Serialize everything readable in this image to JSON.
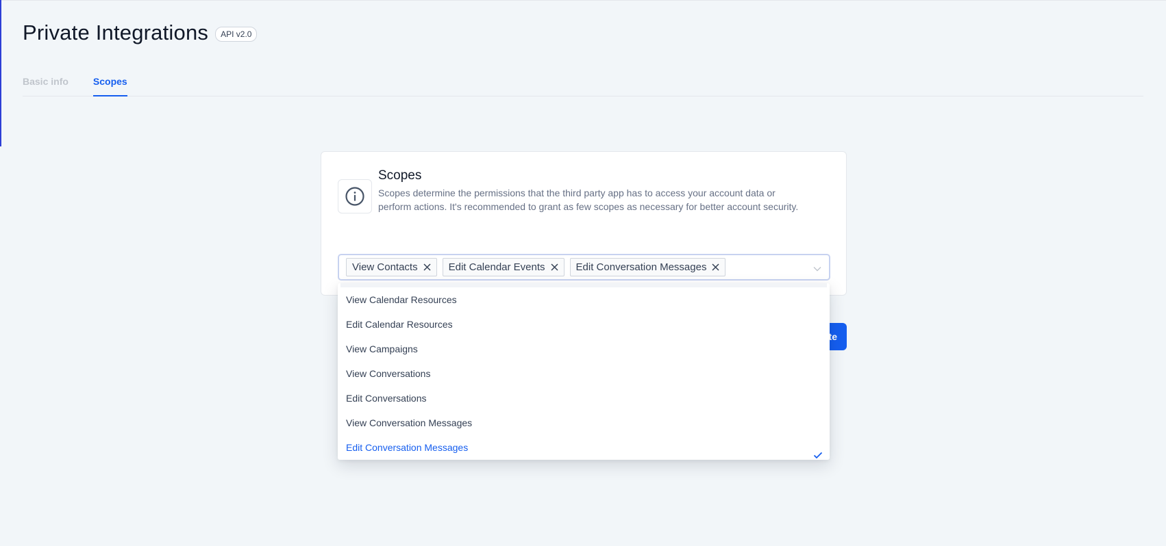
{
  "header": {
    "title": "Private Integrations",
    "api_badge": "API v2.0"
  },
  "tabs": [
    {
      "label": "Basic info",
      "active": false
    },
    {
      "label": "Scopes",
      "active": true
    }
  ],
  "scopes_card": {
    "title": "Scopes",
    "description": "Scopes determine the permissions that the third party app has to access your account data or perform actions. It's recommended to grant as few scopes as necessary for better account security.",
    "icon": "info-icon",
    "selected_tags": [
      {
        "label": "View Contacts"
      },
      {
        "label": "Edit Calendar Events"
      },
      {
        "label": "Edit Conversation Messages"
      }
    ]
  },
  "dropdown": {
    "options": [
      {
        "label": "View Calendar Resources",
        "selected": false
      },
      {
        "label": "Edit Calendar Resources",
        "selected": false
      },
      {
        "label": "View Campaigns",
        "selected": false
      },
      {
        "label": "View Conversations",
        "selected": false
      },
      {
        "label": "Edit Conversations",
        "selected": false
      },
      {
        "label": "View Conversation Messages",
        "selected": false
      },
      {
        "label": "Edit Conversation Messages",
        "selected": true
      }
    ]
  },
  "actions": {
    "create_label_visible": "te"
  },
  "colors": {
    "accent": "#155eef",
    "background": "#f2f6f9",
    "left_accent": "#2d3fd6"
  }
}
